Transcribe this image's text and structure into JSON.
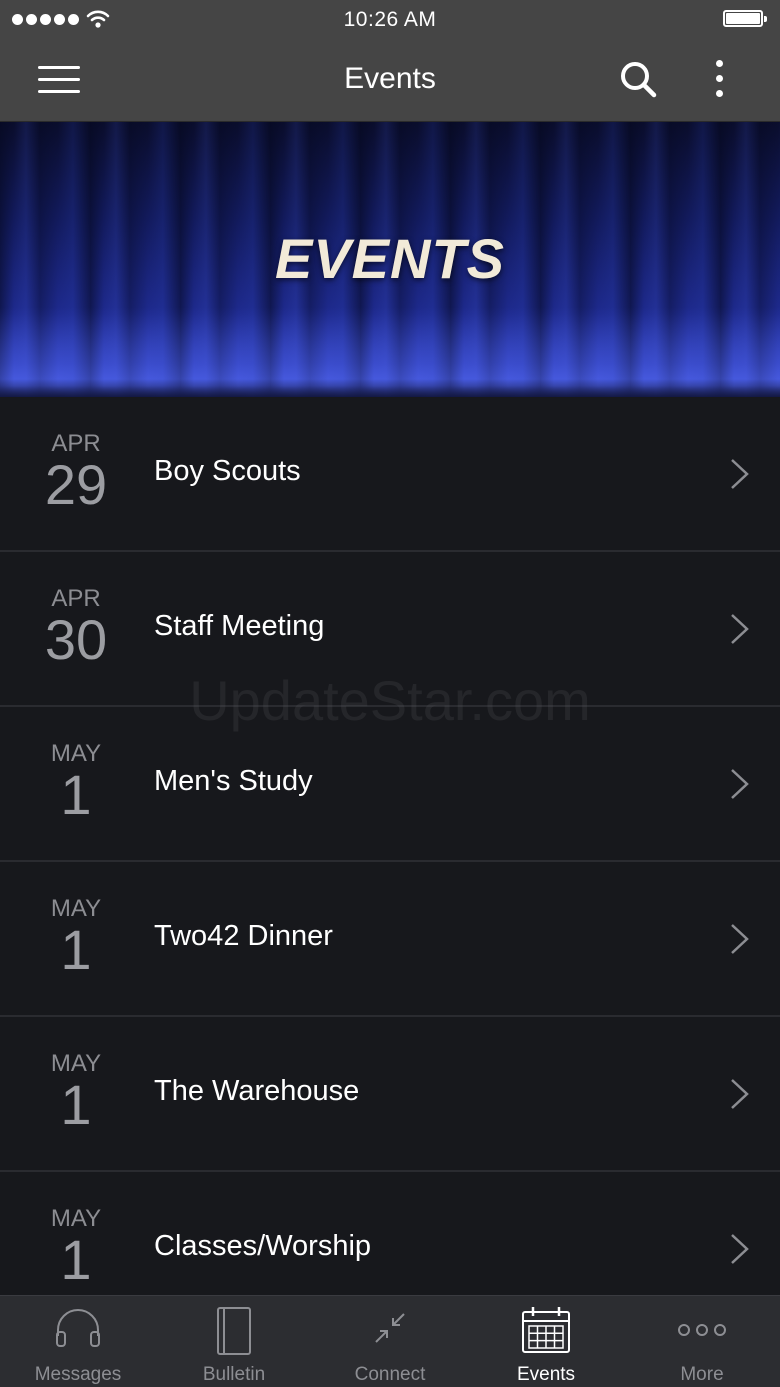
{
  "status_bar": {
    "time": "10:26 AM"
  },
  "nav_bar": {
    "title": "Events"
  },
  "banner": {
    "title": "EVENTS"
  },
  "events": [
    {
      "month": "APR",
      "day": "29",
      "title": "Boy Scouts"
    },
    {
      "month": "APR",
      "day": "30",
      "title": "Staff Meeting"
    },
    {
      "month": "MAY",
      "day": "1",
      "title": "Men's Study"
    },
    {
      "month": "MAY",
      "day": "1",
      "title": "Two42 Dinner"
    },
    {
      "month": "MAY",
      "day": "1",
      "title": "The Warehouse"
    },
    {
      "month": "MAY",
      "day": "1",
      "title": "Classes/Worship"
    }
  ],
  "watermark": "UpdateStar.com",
  "tab_bar": {
    "active_tab": "Events",
    "tabs": [
      {
        "label": "Messages",
        "icon": "headphones-icon"
      },
      {
        "label": "Bulletin",
        "icon": "bulletin-icon"
      },
      {
        "label": "Connect",
        "icon": "connect-icon"
      },
      {
        "label": "Events",
        "icon": "calendar-icon"
      },
      {
        "label": "More",
        "icon": "more-dots-icon"
      }
    ]
  },
  "colors": {
    "nav_background": "#454545",
    "list_background": "#17181c",
    "tab_bar_background": "#2c2d31",
    "active_tab": "#ffffff",
    "inactive_tab": "#8d8e93",
    "banner_blue": "#1e2a8e"
  }
}
